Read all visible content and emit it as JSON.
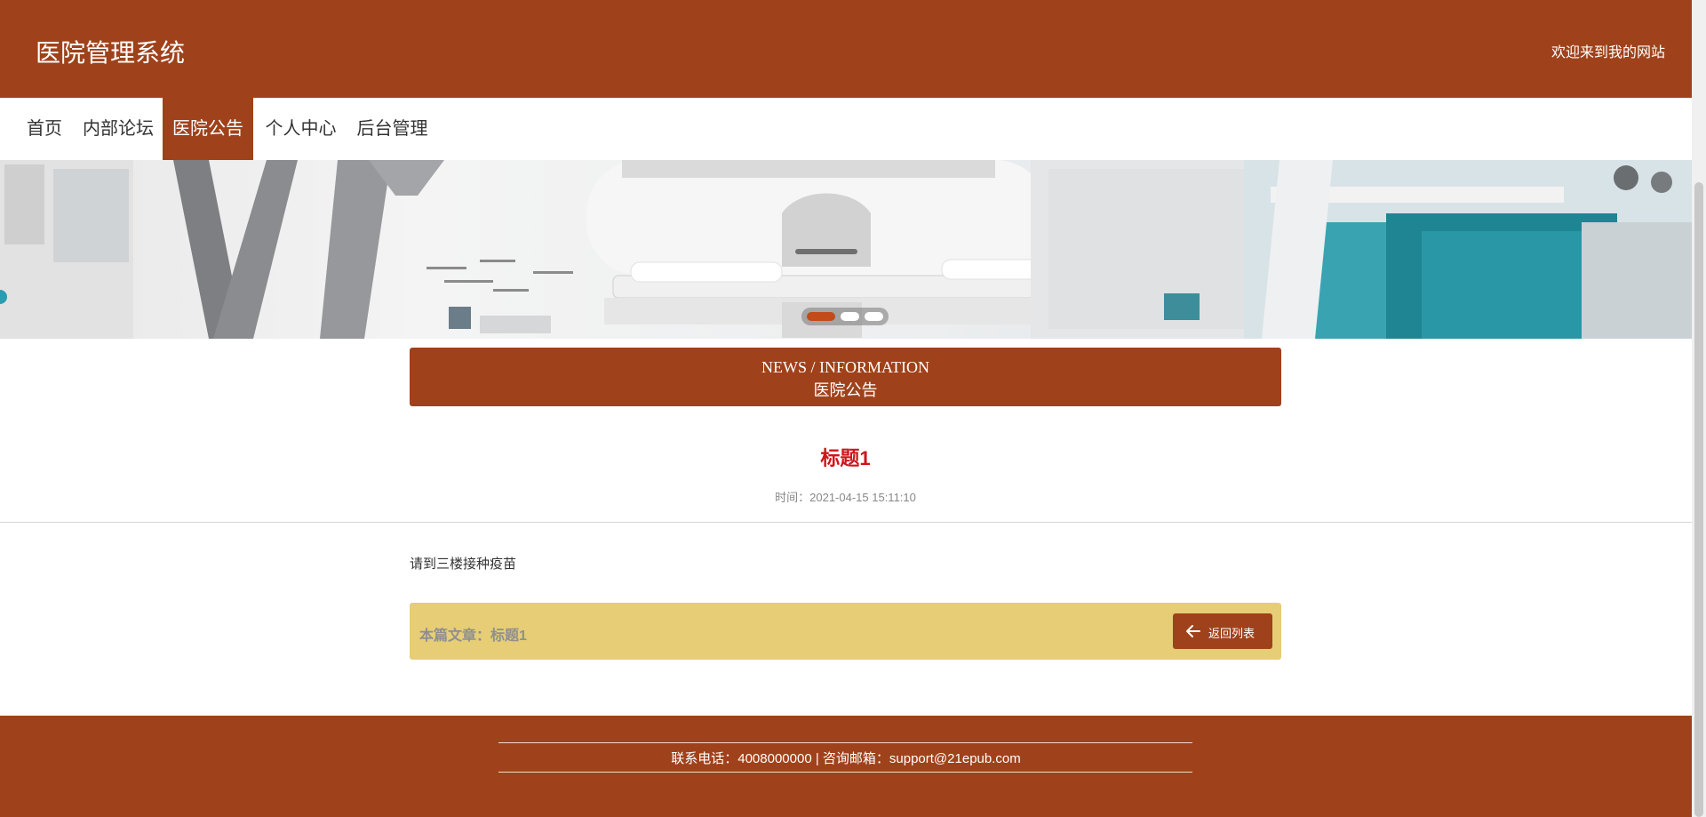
{
  "header": {
    "site_title": "医院管理系统",
    "welcome": "欢迎来到我的网站"
  },
  "nav": {
    "items": [
      "首页",
      "内部论坛",
      "医院公告",
      "个人中心",
      "后台管理"
    ],
    "active": "医院公告"
  },
  "section": {
    "title_en": "NEWS / INFORMATION",
    "title_cn": "医院公告"
  },
  "article": {
    "title": "标题1",
    "time": "时间：2021-04-15 15:11:10",
    "content": "请到三楼接种疫苗",
    "current_label": "本篇文章：标题1",
    "back_label": "返回列表"
  },
  "footer": {
    "contact": "联系电话：4008000000 | 咨询邮箱：support@21epub.com"
  },
  "colors": {
    "primary": "#9f421b",
    "title_red": "#d0141a",
    "bar_yellow": "#e6cd76"
  }
}
